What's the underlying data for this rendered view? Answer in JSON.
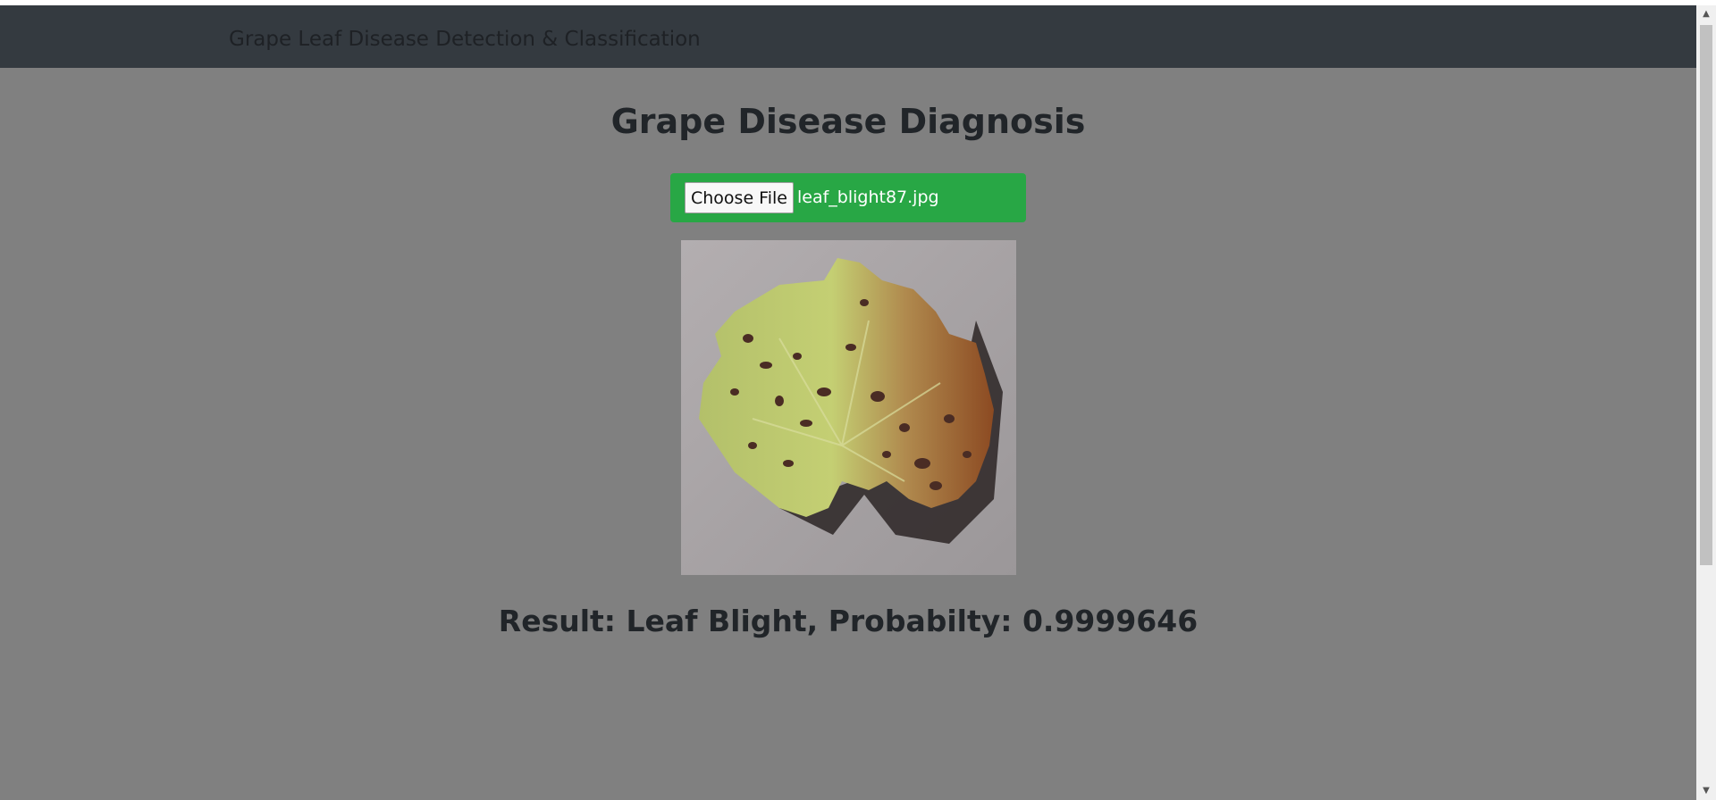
{
  "navbar": {
    "brand": "Grape Leaf Disease Detection & Classification"
  },
  "main": {
    "title": "Grape Disease Diagnosis",
    "file_input": {
      "button_label": "Choose File",
      "file_name": "leaf_blight87.jpg"
    },
    "preview": {
      "subject": "grape leaf with leaf blight spots"
    },
    "result_text": "Result: Leaf Blight, Probabilty: 0.9999646"
  },
  "colors": {
    "page_background": "#808080",
    "navbar_background": "#343a40",
    "file_box": "#28a745",
    "heading_text": "#212529"
  },
  "scrollbar": {
    "up_icon": "triangle-up",
    "down_icon": "triangle-down"
  }
}
